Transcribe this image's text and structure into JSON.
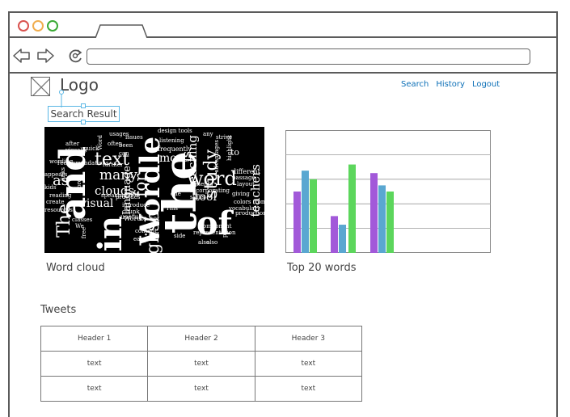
{
  "colors": {
    "link": "#0b6fb7",
    "selection": "#5ab7e5",
    "bar_purple": "#a259d9",
    "bar_blue": "#5aa7d1",
    "bar_green": "#5cd65c"
  },
  "header": {
    "logo_text": "Logo",
    "logo_icon": "image-placeholder-icon",
    "links": [
      "Search",
      "History",
      "Logout"
    ]
  },
  "search_result_label": "Search Result",
  "word_cloud": {
    "caption": "Word cloud",
    "words": [
      "the",
      "and",
      "of",
      "in",
      "Wordle",
      "word",
      "text",
      "as",
      "The",
      "study",
      "many",
      "language",
      "visual",
      "clouds",
      "glish",
      "most",
      "tool",
      "teaching",
      "is",
      "to",
      "teachers",
      "for",
      "design tools",
      "listening",
      "frequently",
      "advantages",
      "strive",
      "highlight",
      "different",
      "passage",
      "layout",
      "colors from",
      "vocabulary",
      "component",
      "Incorporating",
      "skills",
      "representation",
      "introduce",
      "chunk",
      "content",
      "speaking",
      "reading",
      "recommendations",
      "quick",
      "often",
      "further",
      "after",
      "visually",
      "production",
      "benefits",
      "present",
      "useful",
      "Wordle.net",
      "This",
      "classes",
      "We",
      "free",
      "easy",
      "can",
      "one",
      "any",
      "been",
      "Word",
      "also",
      "provides",
      "create",
      "resources",
      "words",
      "appears",
      "kids",
      "wording",
      "links",
      "usages",
      "issues",
      "mind",
      "side",
      "also",
      "giving"
    ]
  },
  "chart_data": {
    "type": "bar",
    "categories": [
      "",
      "",
      "",
      ""
    ],
    "series": [
      {
        "values": [
          5,
          3,
          0,
          6.5
        ]
      },
      {
        "values": [
          6.7,
          2.3,
          0,
          5.5
        ]
      },
      {
        "values": [
          6,
          0,
          0,
          5
        ]
      },
      {
        "values": [
          0,
          0,
          7.2,
          0
        ]
      }
    ],
    "ylim": [
      0,
      10
    ],
    "grid": true
  },
  "chart_caption": "Top 20 words",
  "tweets": {
    "title": "Tweets",
    "headers": [
      "Header 1",
      "Header 2",
      "Header 3"
    ],
    "rows": [
      [
        "text",
        "text",
        "text"
      ],
      [
        "text",
        "text",
        "text"
      ]
    ]
  }
}
